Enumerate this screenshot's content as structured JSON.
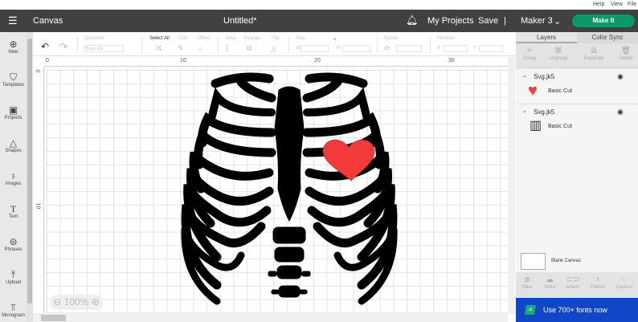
{
  "top_menu": [
    "Help",
    "View",
    "File"
  ],
  "header": {
    "canvas_label": "Canvas",
    "doc_title": "Untitled*",
    "my_projects": "My Projects",
    "save": "Save",
    "machine": "Maker 3",
    "make_it": "Make It"
  },
  "sidebar": [
    {
      "label": "New",
      "icon": "plus-circle-icon"
    },
    {
      "label": "Templates",
      "icon": "shirt-icon"
    },
    {
      "label": "Projects",
      "icon": "clipboard-icon"
    },
    {
      "label": "Shapes",
      "icon": "shapes-icon"
    },
    {
      "label": "Images",
      "icon": "bulb-icon"
    },
    {
      "label": "Text",
      "icon": "text-icon"
    },
    {
      "label": "Phrases",
      "icon": "speech-icon"
    },
    {
      "label": "Upload",
      "icon": "upload-icon"
    },
    {
      "label": "Monogram",
      "icon": "monogram-icon"
    }
  ],
  "toolbar": {
    "operation_label": "Operation",
    "operation_value": "Basic Cut",
    "select_all": "Select All",
    "edit": "Edit",
    "offset": "Offset",
    "align": "Align",
    "arrange": "Arrange",
    "flip": "Flip",
    "size": "Size",
    "w": "W",
    "h": "H",
    "rotate": "Rotate",
    "position": "Position",
    "x": "X",
    "y": "Y"
  },
  "ruler": {
    "h": [
      "0",
      "10",
      "20",
      "30"
    ],
    "v": [
      "0",
      "10"
    ]
  },
  "zoom": "100%",
  "panel": {
    "tabs": [
      "Layers",
      "Color Sync"
    ],
    "actions": [
      "Group",
      "Ungroup",
      "Duplicate",
      "Delete"
    ],
    "layers": [
      {
        "name": "Svg.jk5",
        "sub": "Basic Cut"
      },
      {
        "name": "Svg.jk5",
        "sub": "Basic Cut"
      }
    ],
    "blank_canvas": "Blank Canvas",
    "bottom_actions": [
      "Slice",
      "Weld",
      "Attach",
      "Flatten",
      "Contour"
    ]
  },
  "promo": "Use 700+ fonts now",
  "colors": {
    "header": "#414141",
    "accent": "#0a9a6a",
    "heart": "#f23a3a",
    "promo": "#1046c8"
  }
}
